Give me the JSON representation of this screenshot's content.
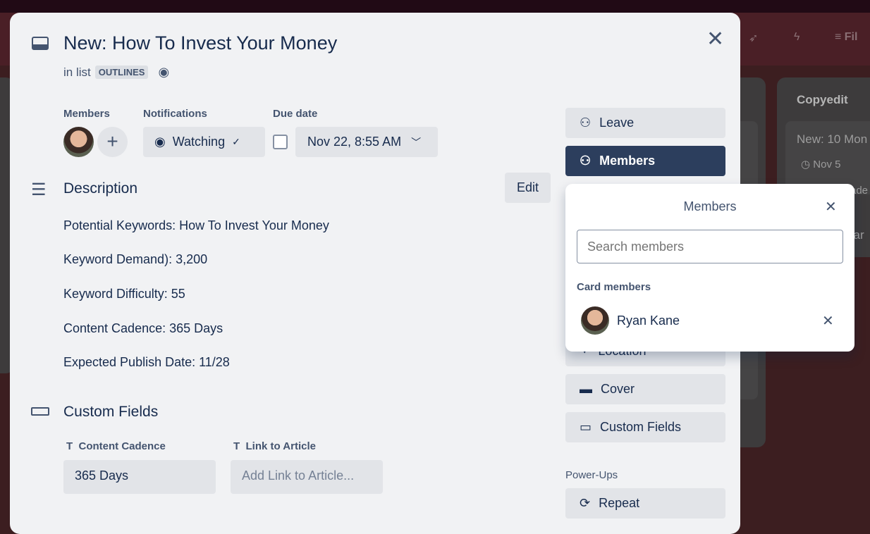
{
  "background": {
    "header_filter": "Fil",
    "list_right_title": "Copyedit",
    "list_right_card_title": "New: 10 Mon",
    "list_right_card_date": "Nov 5",
    "list_right_card_extra": "ade",
    "list_right_card2": "car"
  },
  "card": {
    "title": "New: How To Invest Your Money",
    "in_list_prefix": "in list",
    "list_name": "OUTLINES"
  },
  "members": {
    "label": "Members"
  },
  "notifications": {
    "label": "Notifications",
    "value": "Watching"
  },
  "due_date": {
    "label": "Due date",
    "value": "Nov 22, 8:55 AM",
    "checked": false
  },
  "description": {
    "heading": "Description",
    "edit_label": "Edit",
    "lines": [
      "Potential Keywords:  How To Invest Your Money",
      "Keyword Demand): 3,200",
      "Keyword Difficulty: 55",
      "Content Cadence: 365 Days",
      "Expected Publish Date: 11/28"
    ]
  },
  "custom_fields": {
    "heading": "Custom Fields",
    "fields": [
      {
        "label": "Content Cadence",
        "value": "365 Days",
        "placeholder": ""
      },
      {
        "label": "Link to Article",
        "value": "",
        "placeholder": "Add Link to Article..."
      }
    ]
  },
  "sidebar": {
    "leave": "Leave",
    "members": "Members",
    "location": "Location",
    "cover": "Cover",
    "custom_fields": "Custom Fields",
    "powerups_label": "Power-Ups",
    "repeat": "Repeat"
  },
  "popover": {
    "title": "Members",
    "search_placeholder": "Search members",
    "section_label": "Card members",
    "member_name": "Ryan Kane"
  },
  "colors": {
    "accent": "#2c3e5d",
    "modal_bg": "#f1f2f4"
  }
}
